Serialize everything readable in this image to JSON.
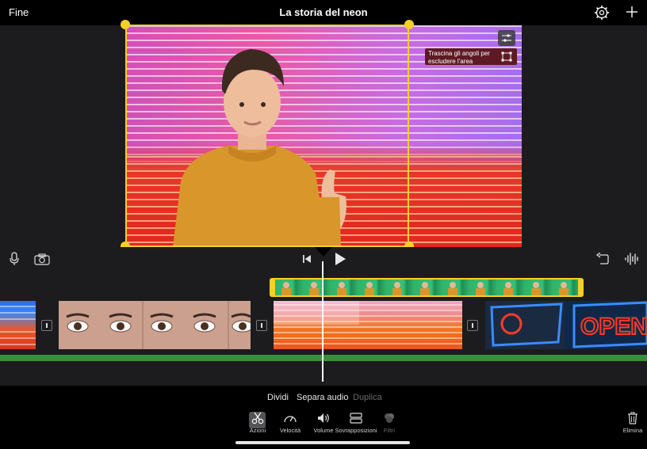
{
  "header": {
    "done_label": "Fine",
    "title": "La storia del neon",
    "settings_icon": "gear-icon",
    "add_icon": "plus-icon"
  },
  "viewer": {
    "hint_text": "Trascina gli angoli per escludere l'area",
    "accent_color": "#f5cf2a"
  },
  "timeline": {
    "icons": [
      "microphone-icon",
      "camera-icon",
      "skip-to-start-icon",
      "play-icon",
      "undo-icon",
      "waveform-icon"
    ]
  },
  "actions": {
    "split": "Dividi",
    "detach_audio": "Separa audio",
    "duplicate": "Duplica"
  },
  "inspector": {
    "tools": [
      {
        "label": "Azioni",
        "icon": "scissors-icon"
      },
      {
        "label": "Velocità",
        "icon": "speedometer-icon"
      },
      {
        "label": "Volume",
        "icon": "speaker-icon"
      },
      {
        "label": "Sovrapposizioni",
        "icon": "overlay-icon"
      },
      {
        "label": "Filtri",
        "icon": "filters-icon"
      }
    ],
    "delete_label": "Elimina"
  }
}
